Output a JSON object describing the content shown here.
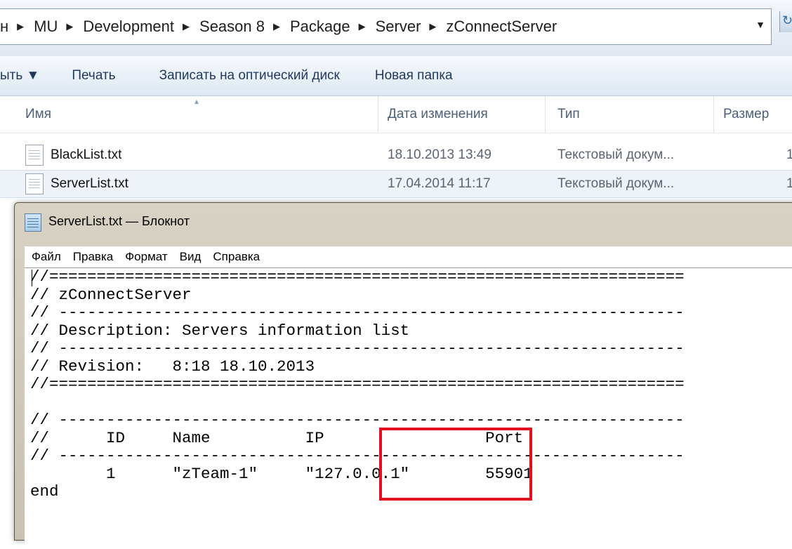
{
  "address_bar": {
    "breadcrumbs": [
      "MU",
      "Development",
      "Season 8",
      "Package",
      "Server",
      "zConnectServer"
    ],
    "leading_fragment": "н",
    "dropdown_icon": "chevron-down-icon",
    "refresh_icon": "refresh-icon"
  },
  "toolbar": {
    "items": [
      "ыть ▼",
      "Печать",
      "Записать на оптический диск",
      "Новая папка"
    ]
  },
  "columns": {
    "name": "Имя",
    "date": "Дата изменения",
    "type": "Тип",
    "size": "Размер"
  },
  "files": [
    {
      "name": "BlackList.txt",
      "date": "18.10.2013 13:49",
      "type": "Текстовый докум...",
      "size": "1"
    },
    {
      "name": "ServerList.txt",
      "date": "17.04.2014 11:17",
      "type": "Текстовый докум...",
      "size": "1"
    }
  ],
  "notepad": {
    "title": "ServerList.txt — Блокнот",
    "menu": [
      "Файл",
      "Правка",
      "Формат",
      "Вид",
      "Справка"
    ],
    "content": "//===================================================================\n// zConnectServer\n// ------------------------------------------------------------------\n// Description: Servers information list\n// ------------------------------------------------------------------\n// Revision:   8:18 18.10.2013\n//===================================================================\n\n// ------------------------------------------------------------------\n//      ID     Name          IP                 Port\n// ------------------------------------------------------------------\n        1      \"zTeam-1\"     \"127.0.0.1\"        55901\nend"
  },
  "colors": {
    "highlight": "#e0121f",
    "explorer_text": "#1e395b"
  }
}
